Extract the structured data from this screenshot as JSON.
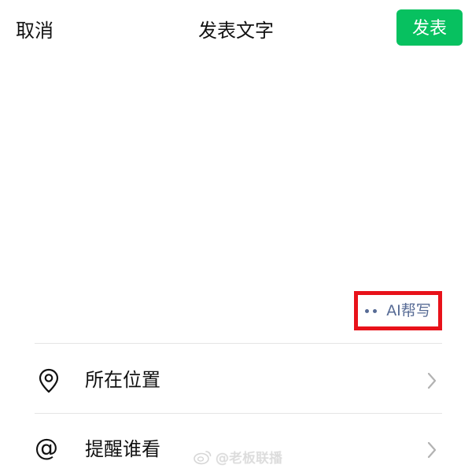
{
  "header": {
    "cancel_label": "取消",
    "title": "发表文字",
    "publish_label": "发表"
  },
  "compose": {
    "value": "",
    "placeholder": ""
  },
  "ai_help": {
    "label": "AI帮写"
  },
  "options": [
    {
      "label": "所在位置",
      "icon": "location-pin-icon"
    },
    {
      "label": "提醒谁看",
      "icon": "at-sign-icon",
      "glyph": "@"
    }
  ],
  "watermark": {
    "text": "@老板联播"
  },
  "colors": {
    "publish_bg": "#07c160",
    "ai_text": "#576b95",
    "highlight_border": "#e8121a",
    "divider": "#e5e5e5"
  }
}
